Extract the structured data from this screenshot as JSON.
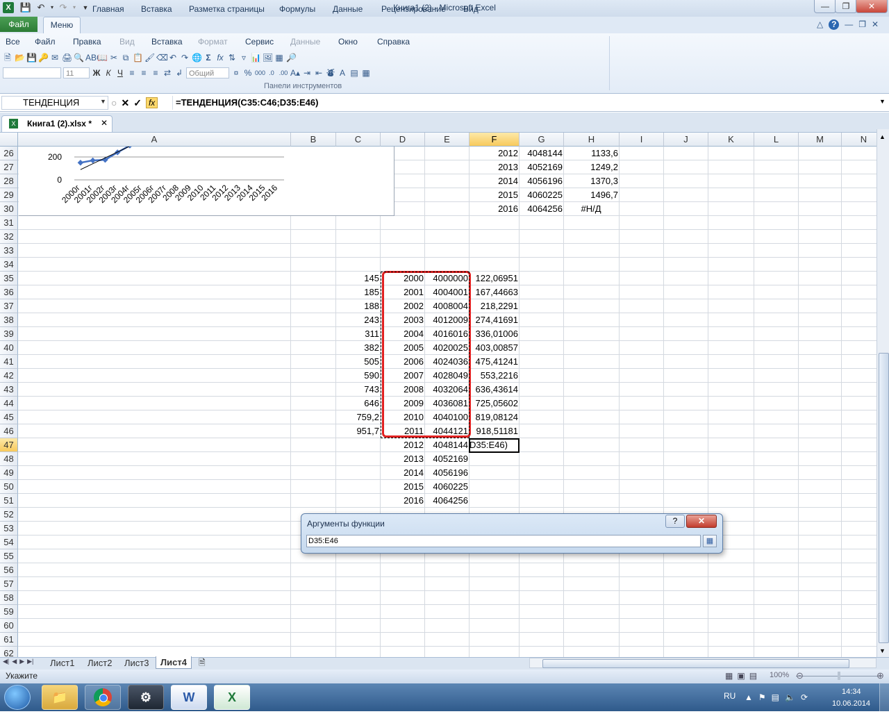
{
  "window": {
    "title": "Книга1 (2) - Microsoft Excel"
  },
  "ribbon_tabs": {
    "file": "Файл",
    "active": "Меню",
    "tabs": [
      "Главная",
      "Вставка",
      "Разметка страницы",
      "Формулы",
      "Данные",
      "Рецензирование",
      "Вид"
    ]
  },
  "menu_bar": {
    "items": [
      "Все",
      "Файл",
      "Правка",
      "Вид",
      "Вставка",
      "Формат",
      "Сервис",
      "Данные",
      "Окно",
      "Справка"
    ],
    "disabled": [
      "Вид",
      "Формат",
      "Данные"
    ]
  },
  "toolbar": {
    "font_name": "",
    "font_size": "11",
    "bold": "Ж",
    "italic": "К",
    "underline": "Ч",
    "number_format": "Общий",
    "group_label": "Панели инструментов"
  },
  "formula_bar": {
    "name_box": "ТЕНДЕНЦИЯ",
    "fx": "fx",
    "formula": "=ТЕНДЕНЦИЯ(C35:C46;D35:E46)"
  },
  "document_tab": {
    "label": "Книга1 (2).xlsx  *"
  },
  "columns": [
    "A",
    "B",
    "C",
    "D",
    "E",
    "F",
    "G",
    "H",
    "I",
    "J",
    "K",
    "L",
    "M",
    "N"
  ],
  "rows": [
    "26",
    "27",
    "28",
    "29",
    "30",
    "31",
    "32",
    "33",
    "34",
    "35",
    "36",
    "37",
    "38",
    "39",
    "40",
    "41",
    "42",
    "43",
    "44",
    "45",
    "46",
    "47",
    "48",
    "49",
    "50",
    "51",
    "52",
    "53",
    "54",
    "55",
    "56",
    "57",
    "58",
    "59",
    "60",
    "61",
    "62"
  ],
  "chart_data": {
    "type": "line",
    "categories": [
      "2000г",
      "2001г",
      "2002г",
      "2003г",
      "2004г",
      "2005г",
      "2006г",
      "2007г",
      "2008",
      "2009",
      "2010",
      "2011",
      "2012",
      "2013",
      "2014",
      "2015",
      "2016"
    ],
    "y_ticks": [
      "200",
      "0"
    ],
    "visible_series_values": [
      150,
      170,
      175,
      240,
      300
    ]
  },
  "cells_upper": [
    {
      "year": "2012",
      "g": "4048144",
      "h": "1133,6"
    },
    {
      "year": "2013",
      "g": "4052169",
      "h": "1249,2"
    },
    {
      "year": "2014",
      "g": "4056196",
      "h": "1370,3"
    },
    {
      "year": "2015",
      "g": "4060225",
      "h": "1496,7"
    },
    {
      "year": "2016",
      "g": "4064256",
      "h": "#Н/Д"
    }
  ],
  "cells_main": [
    {
      "c": "145",
      "d": "2000",
      "e": "4000000",
      "f": "122,06951"
    },
    {
      "c": "185",
      "d": "2001",
      "e": "4004001",
      "f": "167,44663"
    },
    {
      "c": "188",
      "d": "2002",
      "e": "4008004",
      "f": "218,2291"
    },
    {
      "c": "243",
      "d": "2003",
      "e": "4012009",
      "f": "274,41691"
    },
    {
      "c": "311",
      "d": "2004",
      "e": "4016016",
      "f": "336,01006"
    },
    {
      "c": "382",
      "d": "2005",
      "e": "4020025",
      "f": "403,00857"
    },
    {
      "c": "505",
      "d": "2006",
      "e": "4024036",
      "f": "475,41241"
    },
    {
      "c": "590",
      "d": "2007",
      "e": "4028049",
      "f": "553,2216"
    },
    {
      "c": "743",
      "d": "2008",
      "e": "4032064",
      "f": "636,43614"
    },
    {
      "c": "646",
      "d": "2009",
      "e": "4036081",
      "f": "725,05602"
    },
    {
      "c": "759,2",
      "d": "2010",
      "e": "4040100",
      "f": "819,08124"
    },
    {
      "c": "951,7",
      "d": "2011",
      "e": "4044121",
      "f": "918,51181"
    },
    {
      "c": "",
      "d": "2012",
      "e": "4048144",
      "f": "D35:E46)"
    },
    {
      "c": "",
      "d": "2013",
      "e": "4052169",
      "f": ""
    },
    {
      "c": "",
      "d": "2014",
      "e": "4056196",
      "f": ""
    },
    {
      "c": "",
      "d": "2015",
      "e": "4060225",
      "f": ""
    },
    {
      "c": "",
      "d": "2016",
      "e": "4064256",
      "f": ""
    }
  ],
  "dialog": {
    "title": "Аргументы функции",
    "input_value": "D35:E46",
    "help": "?",
    "close": "✕"
  },
  "sheet_tabs": {
    "tabs": [
      "Лист1",
      "Лист2",
      "Лист3",
      "Лист4"
    ],
    "active": "Лист4"
  },
  "status": {
    "mode": "Укажите",
    "zoom": "100%"
  },
  "taskbar": {
    "lang": "RU",
    "time": "14:34",
    "date": "10.06.2014",
    "apps": [
      "explorer",
      "chrome",
      "steam",
      "word",
      "excel"
    ]
  },
  "colors": {
    "accent": "#2c7c36",
    "selection_red": "#e02020",
    "header_active": "#f7c95c"
  }
}
